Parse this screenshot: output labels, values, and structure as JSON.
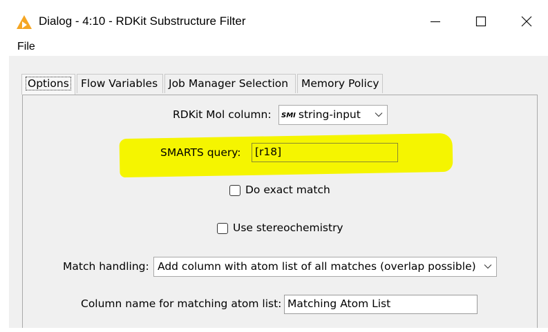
{
  "window": {
    "title": "Dialog - 4:10 - RDKit Substructure Filter",
    "app_icon": "knime-triangle-icon",
    "controls": [
      "minimize-icon",
      "maximize-icon",
      "close-icon"
    ]
  },
  "menu": {
    "file_label": "File"
  },
  "tabs": [
    {
      "label": "Options",
      "selected": true
    },
    {
      "label": "Flow Variables",
      "selected": false
    },
    {
      "label": "Job Manager Selection",
      "selected": false
    },
    {
      "label": "Memory Policy",
      "selected": false
    }
  ],
  "options": {
    "mol_column_label": "RDKit Mol column:",
    "mol_column_type_badge": "SMI",
    "mol_column_value": "string-input",
    "smarts_label": "SMARTS query:",
    "smarts_value": "[r18]",
    "exact_match_label": "Do exact match",
    "exact_match_checked": false,
    "stereo_label": "Use stereochemistry",
    "stereo_checked": false,
    "match_handling_label": "Match handling:",
    "match_handling_value": "Add column with atom list of all matches (overlap possible)",
    "atom_list_label": "Column name for matching atom list:",
    "atom_list_value": "Matching Atom List"
  },
  "colors": {
    "highlight": "#f5f500",
    "window_bg": "#f0f0f0",
    "titlebar_bg": "#ffffff",
    "icon_accent": "#f5a623"
  }
}
